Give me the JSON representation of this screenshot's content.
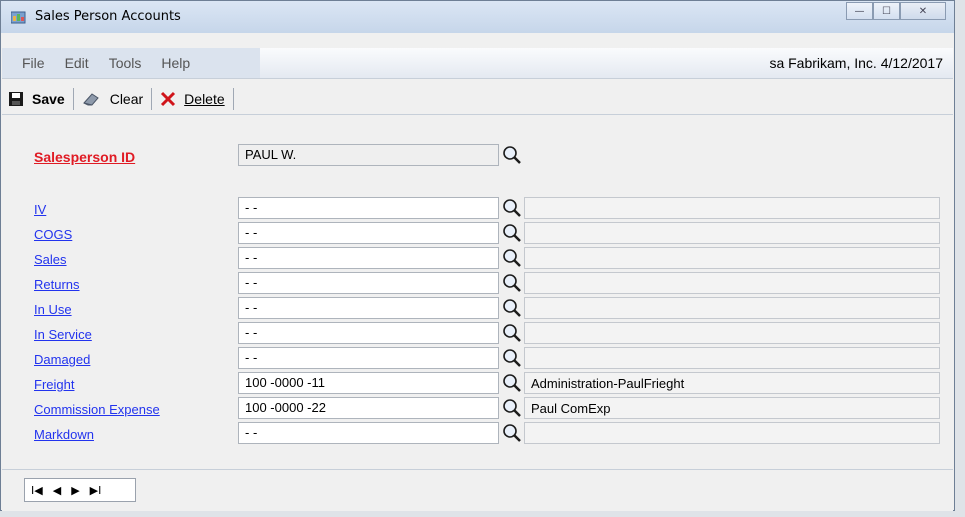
{
  "window": {
    "title": "Sales Person Accounts",
    "minimize_glyph": "—",
    "maximize_glyph": "☐",
    "close_glyph": "✕"
  },
  "menu": {
    "items": [
      "File",
      "Edit",
      "Tools",
      "Help"
    ],
    "company": "sa  Fabrikam, Inc. 4/12/2017"
  },
  "toolbar": {
    "save": "Save",
    "clear": "Clear",
    "delete": "Delete"
  },
  "form": {
    "salesperson_label": "Salesperson ID",
    "salesperson_value": "PAUL W.",
    "accounts": [
      {
        "label": "IV",
        "value": "      -       -",
        "description": ""
      },
      {
        "label": "COGS",
        "value": "      -       -",
        "description": ""
      },
      {
        "label": "Sales",
        "value": "      -       -",
        "description": ""
      },
      {
        "label": "Returns",
        "value": "      -       -",
        "description": ""
      },
      {
        "label": "In Use",
        "value": "      -       -",
        "description": ""
      },
      {
        "label": "In Service",
        "value": "      -       -",
        "description": ""
      },
      {
        "label": "Damaged",
        "value": "      -       -",
        "description": ""
      },
      {
        "label": "Freight",
        "value": "100 -0000 -11",
        "description": "Administration-PaulFrieght"
      },
      {
        "label": "Commission Expense",
        "value": "100 -0000 -22",
        "description": "Paul ComExp"
      },
      {
        "label": "Markdown",
        "value": "      -       -",
        "description": ""
      }
    ]
  },
  "navigation": {
    "first": "I◀",
    "prev": "◀",
    "next": "▶",
    "last": "▶I"
  }
}
